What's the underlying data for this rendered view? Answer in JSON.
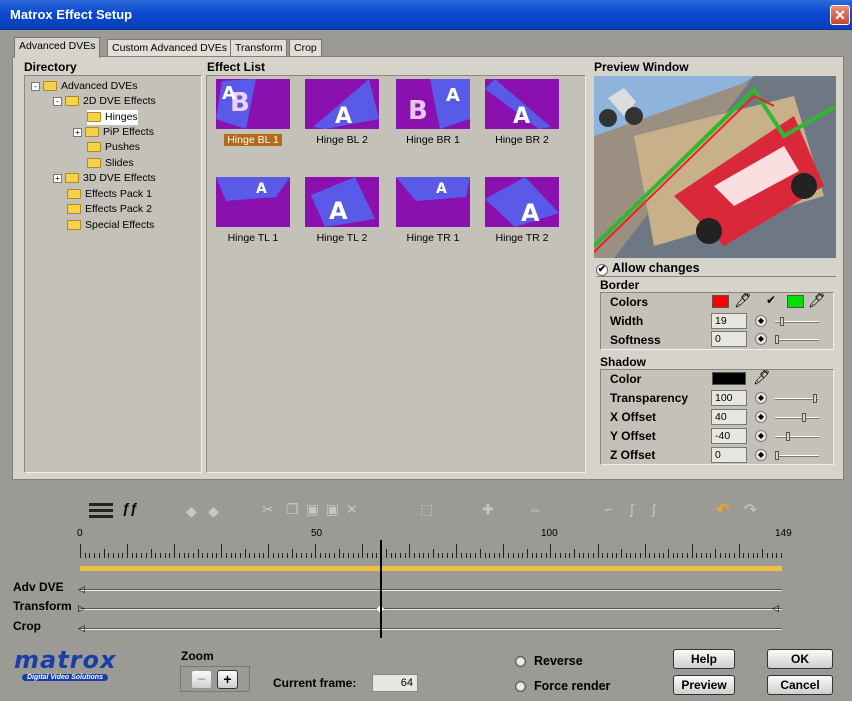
{
  "window": {
    "title": "Matrox Effect Setup",
    "close_glyph": "✕"
  },
  "tabs": [
    {
      "label": "Advanced DVEs",
      "active": true
    },
    {
      "label": "Custom Advanced DVEs",
      "active": false
    },
    {
      "label": "Transform",
      "active": false
    },
    {
      "label": "Crop",
      "active": false
    }
  ],
  "directory": {
    "header": "Directory",
    "items": [
      {
        "label": "Advanced DVEs",
        "expander": "-",
        "level": 0
      },
      {
        "label": "2D DVE Effects",
        "expander": "-",
        "level": 1
      },
      {
        "label": "Hinges",
        "expander": "",
        "level": 2,
        "selected": true
      },
      {
        "label": "PiP Effects",
        "expander": "+",
        "level": 2
      },
      {
        "label": "Pushes",
        "expander": "",
        "level": 2
      },
      {
        "label": "Slides",
        "expander": "",
        "level": 2
      },
      {
        "label": "3D DVE Effects",
        "expander": "+",
        "level": 1
      },
      {
        "label": "Effects Pack 1",
        "expander": "",
        "level": 1
      },
      {
        "label": "Effects Pack 2",
        "expander": "",
        "level": 1
      },
      {
        "label": "Special Effects",
        "expander": "",
        "level": 1
      }
    ]
  },
  "effect_list": {
    "header": "Effect List",
    "items": [
      {
        "label": "Hinge BL 1",
        "selected": true
      },
      {
        "label": "Hinge BL 2"
      },
      {
        "label": "Hinge BR 1"
      },
      {
        "label": "Hinge BR 2"
      },
      {
        "label": "Hinge TL 1"
      },
      {
        "label": "Hinge TL 2"
      },
      {
        "label": "Hinge TR 1"
      },
      {
        "label": "Hinge TR 2"
      }
    ]
  },
  "preview": {
    "header": "Preview Window"
  },
  "allow_changes": {
    "label": "Allow changes",
    "checked": true
  },
  "border": {
    "header": "Border",
    "colors_label": "Colors",
    "color1": "#ff0000",
    "color2": "#00e000",
    "color2_enabled": true,
    "width_label": "Width",
    "width_value": "19",
    "width_level": 0.13,
    "softness_label": "Softness",
    "softness_value": "0",
    "softness_level": 0
  },
  "shadow": {
    "header": "Shadow",
    "color_label": "Color",
    "color": "#000000",
    "transparency_label": "Transparency",
    "transparency_value": "100",
    "transparency_level": 1.0,
    "x_offset_label": "X Offset",
    "x_offset_value": "40",
    "x_offset_level": 0.7,
    "y_offset_label": "Y Offset",
    "y_offset_value": "-40",
    "y_offset_level": 0.3,
    "z_offset_label": "Z Offset",
    "z_offset_value": "0",
    "z_offset_level": 0
  },
  "timeline": {
    "ruler_labels": [
      "0",
      "50",
      "100",
      "149"
    ],
    "ruler_max": 149,
    "current_frame_value": 64,
    "keyframe_transform": 64,
    "tracks": [
      "Adv DVE",
      "Transform",
      "Crop"
    ]
  },
  "bottom": {
    "logo_text": "matrox",
    "logo_sub": "Digital Video Solutions",
    "zoom_label": "Zoom",
    "zoom_minus": "−",
    "zoom_plus": "+",
    "current_frame_label": "Current frame:",
    "current_frame": "64",
    "reverse_label": "Reverse",
    "force_render_label": "Force render",
    "help_label": "Help",
    "ok_label": "OK",
    "preview_label": "Preview",
    "cancel_label": "Cancel"
  }
}
